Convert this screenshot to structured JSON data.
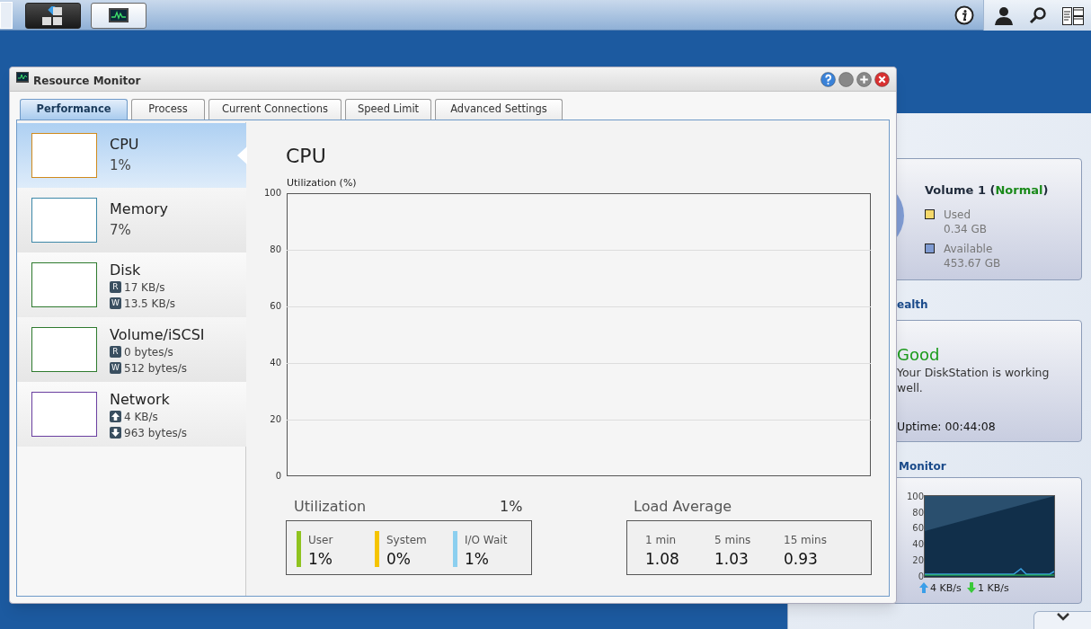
{
  "taskbar": {
    "apps": [
      {
        "kind": "main-menu",
        "selected": true
      },
      {
        "kind": "resource-monitor",
        "selected": false
      }
    ]
  },
  "window": {
    "title": "Resource Monitor"
  },
  "tabs": [
    {
      "label": "Performance",
      "selected": true
    },
    {
      "label": "Process",
      "selected": false
    },
    {
      "label": "Current Connections",
      "selected": false
    },
    {
      "label": "Speed Limit",
      "selected": false
    },
    {
      "label": "Advanced Settings",
      "selected": false
    }
  ],
  "sidebar": {
    "items": [
      {
        "name": "CPU",
        "selected": true,
        "color": "#d08a1c",
        "lines": [
          {
            "kind": "big",
            "text": "1%"
          }
        ]
      },
      {
        "name": "Memory",
        "selected": false,
        "color": "#3d88a8",
        "lines": [
          {
            "kind": "big",
            "text": "7%"
          }
        ]
      },
      {
        "name": "Disk",
        "selected": false,
        "color": "#2e7a2e",
        "lines": [
          {
            "kind": "badge",
            "badge": "R",
            "text": "17 KB/s"
          },
          {
            "kind": "badge",
            "badge": "W",
            "text": "13.5 KB/s"
          }
        ]
      },
      {
        "name": "Volume/iSCSI",
        "selected": false,
        "color": "#2e7a2e",
        "lines": [
          {
            "kind": "badge",
            "badge": "R",
            "text": "0 bytes/s"
          },
          {
            "kind": "badge",
            "badge": "W",
            "text": "512 bytes/s"
          }
        ]
      },
      {
        "name": "Network",
        "selected": false,
        "color": "#6a3fa0",
        "lines": [
          {
            "kind": "up",
            "text": "4 KB/s"
          },
          {
            "kind": "down",
            "text": "963 bytes/s"
          }
        ]
      }
    ]
  },
  "main": {
    "title": "CPU",
    "chart": {
      "ylabel": "Utilization (%)",
      "axis_labels": [
        "100",
        "80",
        "60",
        "40",
        "20",
        "0"
      ]
    },
    "utilization": {
      "label": "Utilization",
      "value": "1%",
      "items": [
        {
          "label": "User",
          "value": "1%",
          "color": "#8fc31f"
        },
        {
          "label": "System",
          "value": "0%",
          "color": "#f5c400"
        },
        {
          "label": "I/O Wait",
          "value": "1%",
          "color": "#8ccfef"
        }
      ]
    },
    "load_average": {
      "label": "Load Average",
      "items": [
        {
          "label": "1 min",
          "value": "1.08"
        },
        {
          "label": "5 mins",
          "value": "1.03"
        },
        {
          "label": "15 mins",
          "value": "0.93"
        }
      ]
    }
  },
  "widgets": {
    "volume": {
      "name": "Volume 1 (",
      "status": "Normal",
      "name_end": ")",
      "legend": [
        {
          "label": "Used",
          "value": "0.34 GB",
          "color": "#f5d86a"
        },
        {
          "label": "Available",
          "value": "453.67 GB",
          "color": "#7f9bd2"
        }
      ]
    },
    "health": {
      "title": "ealth",
      "status": "Good",
      "message": "Your DiskStation is working well.",
      "uptime": "Uptime: 00:44:08"
    },
    "monitor": {
      "title": "Monitor",
      "axis_labels": [
        "100",
        "80",
        "60",
        "40",
        "20",
        "0"
      ],
      "upload": "4 KB/s",
      "download": "1 KB/s"
    }
  }
}
